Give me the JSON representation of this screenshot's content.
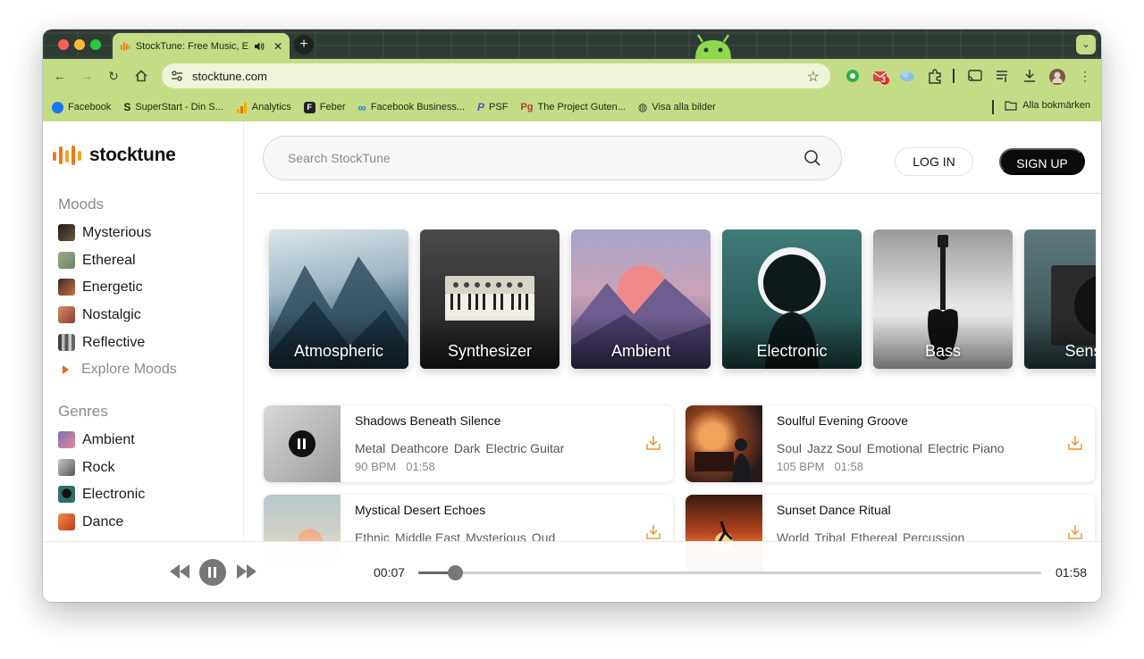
{
  "browser": {
    "tab": {
      "title": "StockTune: Free Music, Enjoy Stock Music"
    },
    "address": {
      "url": "stocktune.com"
    },
    "bookmarks": [
      {
        "label": "Facebook",
        "icon": "facebook-icon",
        "color": "#1877f2"
      },
      {
        "label": "SuperStart - Din S...",
        "icon": "superstart-icon",
        "color": "#1d2a12"
      },
      {
        "label": "Analytics",
        "icon": "analytics-icon",
        "color": "#f4a300"
      },
      {
        "label": "Feber",
        "icon": "feber-icon",
        "color": "#222222"
      },
      {
        "label": "Facebook Business...",
        "icon": "meta-icon",
        "color": "#1877f2"
      },
      {
        "label": "PSF",
        "icon": "psf-icon",
        "color": "#5b4ccf"
      },
      {
        "label": "The Project Guten...",
        "icon": "gutenberg-icon",
        "color": "#b33a3a"
      },
      {
        "label": "Visa alla bilder",
        "icon": "globe-icon",
        "color": "#333333"
      }
    ],
    "all_bookmarks": "Alla bokmärken",
    "badge_count": "3"
  },
  "site": {
    "logo_text": "stocktune",
    "brand_color": "#f07a1a",
    "search_placeholder": "Search StockTune",
    "login_label": "LOG IN",
    "signup_label": "SIGN UP"
  },
  "sidebar": {
    "moods_title": "Moods",
    "moods": [
      "Mysterious",
      "Ethereal",
      "Energetic",
      "Nostalgic",
      "Reflective"
    ],
    "explore_moods": "Explore Moods",
    "genres_title": "Genres",
    "genres": [
      "Ambient",
      "Rock",
      "Electronic",
      "Dance"
    ]
  },
  "categories": [
    "Atmospheric",
    "Synthesizer",
    "Ambient",
    "Electronic",
    "Bass",
    "Sensual"
  ],
  "tracks": [
    {
      "title": "Shadows Beneath Silence",
      "tags": [
        "Metal",
        "Deathcore",
        "Dark",
        "Electric Guitar"
      ],
      "bpm": "90 BPM",
      "duration": "01:58",
      "playing": true
    },
    {
      "title": "Soulful Evening Groove",
      "tags": [
        "Soul",
        "Jazz Soul",
        "Emotional",
        "Electric Piano"
      ],
      "bpm": "105 BPM",
      "duration": "01:58",
      "playing": false
    },
    {
      "title": "Mystical Desert Echoes",
      "tags": [
        "Ethnic",
        "Middle East",
        "Mysterious",
        "Oud"
      ],
      "bpm": "",
      "duration": "",
      "playing": false
    },
    {
      "title": "Sunset Dance Ritual",
      "tags": [
        "World",
        "Tribal",
        "Ethereal",
        "Percussion"
      ],
      "bpm": "",
      "duration": "",
      "playing": false
    }
  ],
  "player": {
    "current_time": "00:07",
    "total_time": "01:58",
    "progress": 0.059
  }
}
